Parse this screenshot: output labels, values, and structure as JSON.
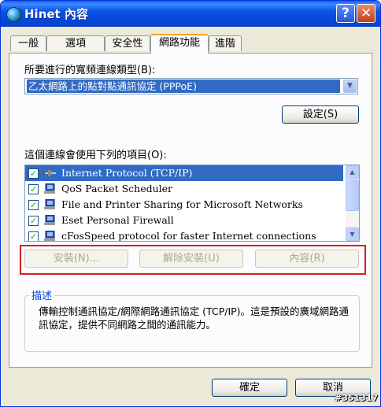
{
  "window": {
    "title": "Hinet 內容",
    "help_button": "?",
    "close_button": "✕"
  },
  "tabs": [
    {
      "label": "一般"
    },
    {
      "label": "選項"
    },
    {
      "label": "安全性"
    },
    {
      "label": "網路功能"
    },
    {
      "label": "進階"
    }
  ],
  "networking": {
    "connection_type_label": "所要進行的寬頻連線類型(B):",
    "connection_type_value": "乙太網路上的點對點通訊協定 (PPPoE)",
    "settings_button": "設定(S)",
    "components_label": "這個連線會使用下列的項目(O):",
    "components": [
      {
        "label": "Internet Protocol (TCP/IP)",
        "checked": true,
        "selected": true,
        "icon": "protocol-icon"
      },
      {
        "label": "QoS Packet Scheduler",
        "checked": true,
        "selected": false,
        "icon": "service-icon"
      },
      {
        "label": "File and Printer Sharing for Microsoft Networks",
        "checked": true,
        "selected": false,
        "icon": "service-icon"
      },
      {
        "label": "Eset Personal Firewall",
        "checked": true,
        "selected": false,
        "icon": "service-icon"
      },
      {
        "label": "cFosSpeed protocol for faster Internet connections",
        "checked": true,
        "selected": false,
        "icon": "service-icon"
      }
    ],
    "install_button": "安裝(N)...",
    "uninstall_button": "解除安裝(U)",
    "properties_button": "內容(R)",
    "description_title": "描述",
    "description_text": "傳輸控制通訊協定/網際網路通訊協定 (TCP/IP)。這是預設的廣域網路通訊協定，提供不同網路之間的通訊能力。"
  },
  "footer": {
    "ok_button": "確定",
    "cancel_button": "取消"
  },
  "watermark": "#351317",
  "colors": {
    "selection": "#316ac5",
    "title_bar": "#0a54e4",
    "highlight_box": "#d32020",
    "active_tab_accent": "#f6a22a"
  }
}
